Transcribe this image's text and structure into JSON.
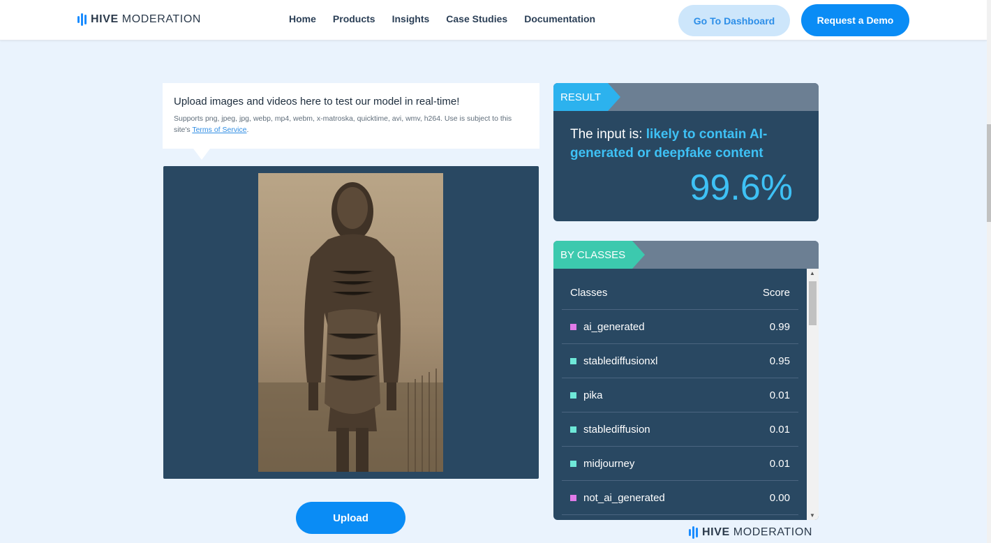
{
  "brand": {
    "name_bold": "HIVE",
    "name_rest": "MODERATION"
  },
  "nav": {
    "items": [
      "Home",
      "Products",
      "Insights",
      "Case Studies",
      "Documentation"
    ]
  },
  "header_buttons": {
    "dashboard": "Go To Dashboard",
    "demo": "Request a Demo"
  },
  "upload_info": {
    "title": "Upload images and videos here to test our model in real-time!",
    "desc": "Supports png, jpeg, jpg, webp, mp4, webm, x-matroska, quicktime, avi, wmv, h264. Use is subject to this site's ",
    "tos_link": "Terms of Service",
    "tail": "."
  },
  "upload_button": "Upload",
  "result": {
    "label": "RESULT",
    "prefix": "The input is: ",
    "verdict": "likely to contain AI-generated or deepfake content",
    "percent": "99.6%"
  },
  "by_classes": {
    "label": "BY CLASSES",
    "col_class": "Classes",
    "col_score": "Score",
    "rows": [
      {
        "name": "ai_generated",
        "score": "0.99",
        "color": "#e07be8"
      },
      {
        "name": "stablediffusionxl",
        "score": "0.95",
        "color": "#6ee8d8"
      },
      {
        "name": "pika",
        "score": "0.01",
        "color": "#6ee8d8"
      },
      {
        "name": "stablediffusion",
        "score": "0.01",
        "color": "#6ee8d8"
      },
      {
        "name": "midjourney",
        "score": "0.01",
        "color": "#6ee8d8"
      },
      {
        "name": "not_ai_generated",
        "score": "0.00",
        "color": "#e07be8"
      }
    ]
  }
}
